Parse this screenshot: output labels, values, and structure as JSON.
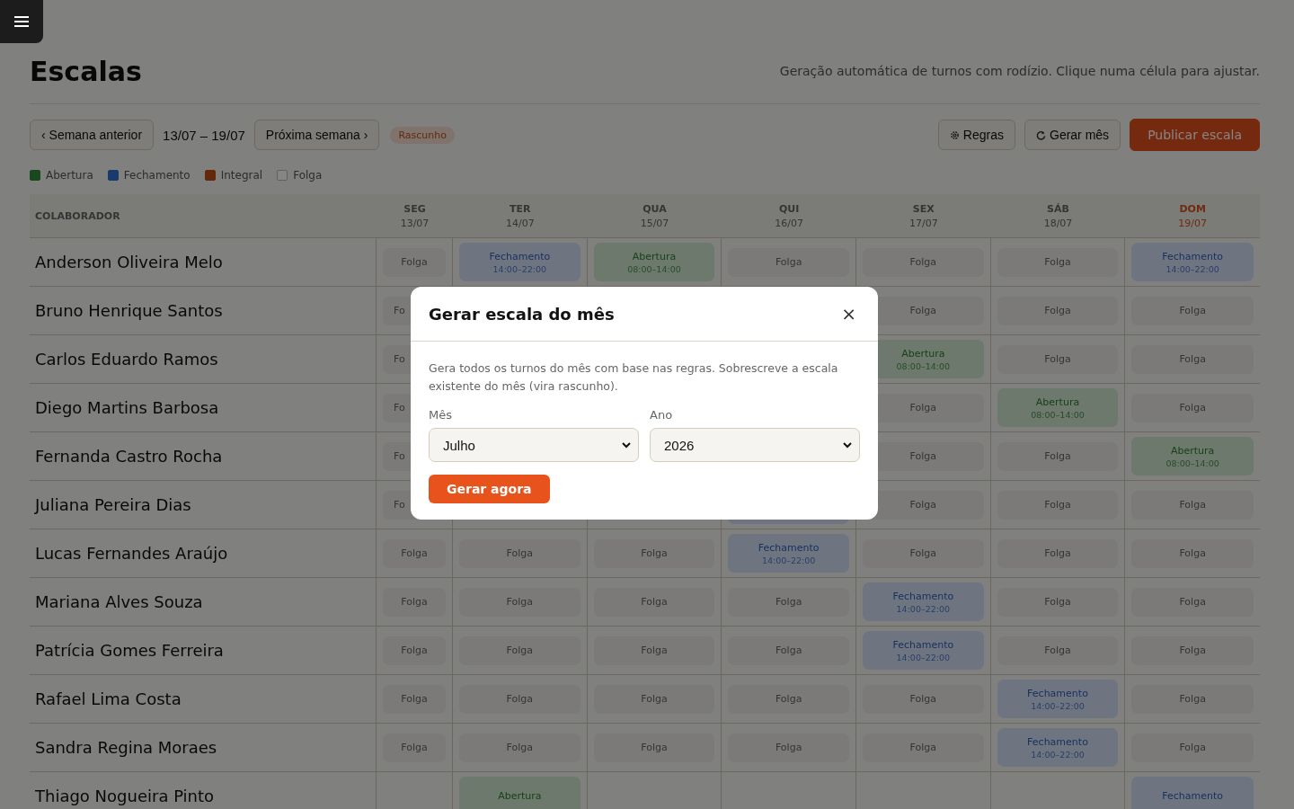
{
  "page": {
    "title": "Escalas",
    "subtitle": "Geração automática de turnos com rodízio. Clique numa célula para ajustar."
  },
  "toolbar": {
    "prev": "‹ Semana anterior",
    "range": "13/07 – 19/07",
    "next": "Próxima semana ›",
    "status": "Rascunho",
    "actions": [
      {
        "kind": "rules",
        "label": "Regras"
      },
      {
        "kind": "generate",
        "label": "Gerar mês"
      },
      {
        "kind": "publish",
        "label": "Publicar escala"
      }
    ]
  },
  "legend": [
    {
      "label": "Abertura",
      "kind": "abertura"
    },
    {
      "label": "Fechamento",
      "kind": "fechamento"
    },
    {
      "label": "Integral",
      "kind": "integral"
    },
    {
      "label": "Folga",
      "kind": "folga"
    }
  ],
  "table": {
    "name_column": "COLABORADOR",
    "days": [
      {
        "day": "SEG",
        "date": "13/07",
        "weekend": false
      },
      {
        "day": "TER",
        "date": "14/07",
        "weekend": false
      },
      {
        "day": "QUA",
        "date": "15/07",
        "weekend": false
      },
      {
        "day": "QUI",
        "date": "16/07",
        "weekend": false
      },
      {
        "day": "SEX",
        "date": "17/07",
        "weekend": false
      },
      {
        "day": "SÁB",
        "date": "18/07",
        "weekend": false
      },
      {
        "day": "DOM",
        "date": "19/07",
        "weekend": true
      }
    ],
    "rows": [
      {
        "name": "Anderson Oliveira Melo",
        "cells": [
          {
            "kind": "folga",
            "label": "Folga"
          },
          {
            "kind": "fechamento",
            "label": "Fechamento",
            "time": "14:00–22:00"
          },
          {
            "kind": "abertura",
            "label": "Abertura",
            "time": "08:00–14:00"
          },
          {
            "kind": "folga",
            "label": "Folga"
          },
          {
            "kind": "folga",
            "label": "Folga"
          },
          {
            "kind": "folga",
            "label": "Folga"
          },
          {
            "kind": "fechamento",
            "label": "Fechamento",
            "time": "14:00–22:00"
          }
        ]
      },
      {
        "name": "Bruno Henrique Santos",
        "cells": [
          {
            "kind": "partial",
            "label": "Fo"
          },
          {
            "kind": "covered"
          },
          {
            "kind": "covered"
          },
          {
            "kind": "covered"
          },
          {
            "kind": "folga",
            "label": "Folga"
          },
          {
            "kind": "folga",
            "label": "Folga"
          },
          {
            "kind": "folga",
            "label": "Folga"
          }
        ]
      },
      {
        "name": "Carlos Eduardo Ramos",
        "cells": [
          {
            "kind": "partial",
            "label": "Fo"
          },
          {
            "kind": "covered"
          },
          {
            "kind": "covered"
          },
          {
            "kind": "covered"
          },
          {
            "kind": "abertura",
            "label": "Abertura",
            "time": "08:00–14:00"
          },
          {
            "kind": "folga",
            "label": "Folga"
          },
          {
            "kind": "folga",
            "label": "Folga"
          }
        ]
      },
      {
        "name": "Diego Martins Barbosa",
        "cells": [
          {
            "kind": "partial",
            "label": "Fo"
          },
          {
            "kind": "covered"
          },
          {
            "kind": "covered"
          },
          {
            "kind": "covered"
          },
          {
            "kind": "folga",
            "label": "Folga"
          },
          {
            "kind": "abertura",
            "label": "Abertura",
            "time": "08:00–14:00"
          },
          {
            "kind": "folga",
            "label": "Folga"
          }
        ]
      },
      {
        "name": "Fernanda Castro Rocha",
        "cells": [
          {
            "kind": "partial",
            "label": "Fo"
          },
          {
            "kind": "covered"
          },
          {
            "kind": "covered"
          },
          {
            "kind": "covered"
          },
          {
            "kind": "folga",
            "label": "Folga"
          },
          {
            "kind": "folga",
            "label": "Folga"
          },
          {
            "kind": "abertura",
            "label": "Abertura",
            "time": "08:00–14:00"
          }
        ]
      },
      {
        "name": "Juliana Pereira Dias",
        "cells": [
          {
            "kind": "partial",
            "label": "Fo"
          },
          {
            "kind": "covered"
          },
          {
            "kind": "covered"
          },
          {
            "kind": "fechamento"
          },
          {
            "kind": "folga",
            "label": "Folga"
          },
          {
            "kind": "folga",
            "label": "Folga"
          },
          {
            "kind": "folga",
            "label": "Folga"
          }
        ]
      },
      {
        "name": "Lucas Fernandes Araújo",
        "cells": [
          {
            "kind": "folga",
            "label": "Folga"
          },
          {
            "kind": "folga",
            "label": "Folga"
          },
          {
            "kind": "folga",
            "label": "Folga"
          },
          {
            "kind": "fechamento",
            "label": "Fechamento",
            "time": "14:00–22:00"
          },
          {
            "kind": "folga",
            "label": "Folga"
          },
          {
            "kind": "folga",
            "label": "Folga"
          },
          {
            "kind": "folga",
            "label": "Folga"
          }
        ]
      },
      {
        "name": "Mariana Alves Souza",
        "cells": [
          {
            "kind": "folga",
            "label": "Folga"
          },
          {
            "kind": "folga",
            "label": "Folga"
          },
          {
            "kind": "folga",
            "label": "Folga"
          },
          {
            "kind": "folga",
            "label": "Folga"
          },
          {
            "kind": "fechamento",
            "label": "Fechamento",
            "time": "14:00–22:00"
          },
          {
            "kind": "folga",
            "label": "Folga"
          },
          {
            "kind": "folga",
            "label": "Folga"
          }
        ]
      },
      {
        "name": "Patrícia Gomes Ferreira",
        "cells": [
          {
            "kind": "folga",
            "label": "Folga"
          },
          {
            "kind": "folga",
            "label": "Folga"
          },
          {
            "kind": "folga",
            "label": "Folga"
          },
          {
            "kind": "folga",
            "label": "Folga"
          },
          {
            "kind": "fechamento",
            "label": "Fechamento",
            "time": "14:00–22:00"
          },
          {
            "kind": "folga",
            "label": "Folga"
          },
          {
            "kind": "folga",
            "label": "Folga"
          }
        ]
      },
      {
        "name": "Rafael Lima Costa",
        "cells": [
          {
            "kind": "folga",
            "label": "Folga"
          },
          {
            "kind": "folga",
            "label": "Folga"
          },
          {
            "kind": "folga",
            "label": "Folga"
          },
          {
            "kind": "folga",
            "label": "Folga"
          },
          {
            "kind": "folga",
            "label": "Folga"
          },
          {
            "kind": "fechamento",
            "label": "Fechamento",
            "time": "14:00–22:00"
          },
          {
            "kind": "folga",
            "label": "Folga"
          }
        ]
      },
      {
        "name": "Sandra Regina Moraes",
        "cells": [
          {
            "kind": "folga",
            "label": "Folga"
          },
          {
            "kind": "folga",
            "label": "Folga"
          },
          {
            "kind": "folga",
            "label": "Folga"
          },
          {
            "kind": "folga",
            "label": "Folga"
          },
          {
            "kind": "folga",
            "label": "Folga"
          },
          {
            "kind": "fechamento",
            "label": "Fechamento",
            "time": "14:00–22:00"
          },
          {
            "kind": "folga",
            "label": "Folga"
          }
        ]
      },
      {
        "name": "Thiago Nogueira Pinto",
        "cells": [
          {
            "kind": "blank"
          },
          {
            "kind": "abertura",
            "label": "Abertura"
          },
          {
            "kind": "blank"
          },
          {
            "kind": "blank"
          },
          {
            "kind": "blank"
          },
          {
            "kind": "blank"
          },
          {
            "kind": "fechamento",
            "label": "Fechamento"
          }
        ]
      }
    ]
  },
  "dialog": {
    "title": "Gerar escala do mês",
    "close": "×",
    "description": "Gera todos os turnos do mês com base nas regras. Sobrescreve a escala existente do mês (vira rascunho).",
    "fields": [
      {
        "label": "Mês",
        "value": "Julho"
      },
      {
        "label": "Ano",
        "value": "2026"
      }
    ],
    "submit": "Gerar agora"
  }
}
